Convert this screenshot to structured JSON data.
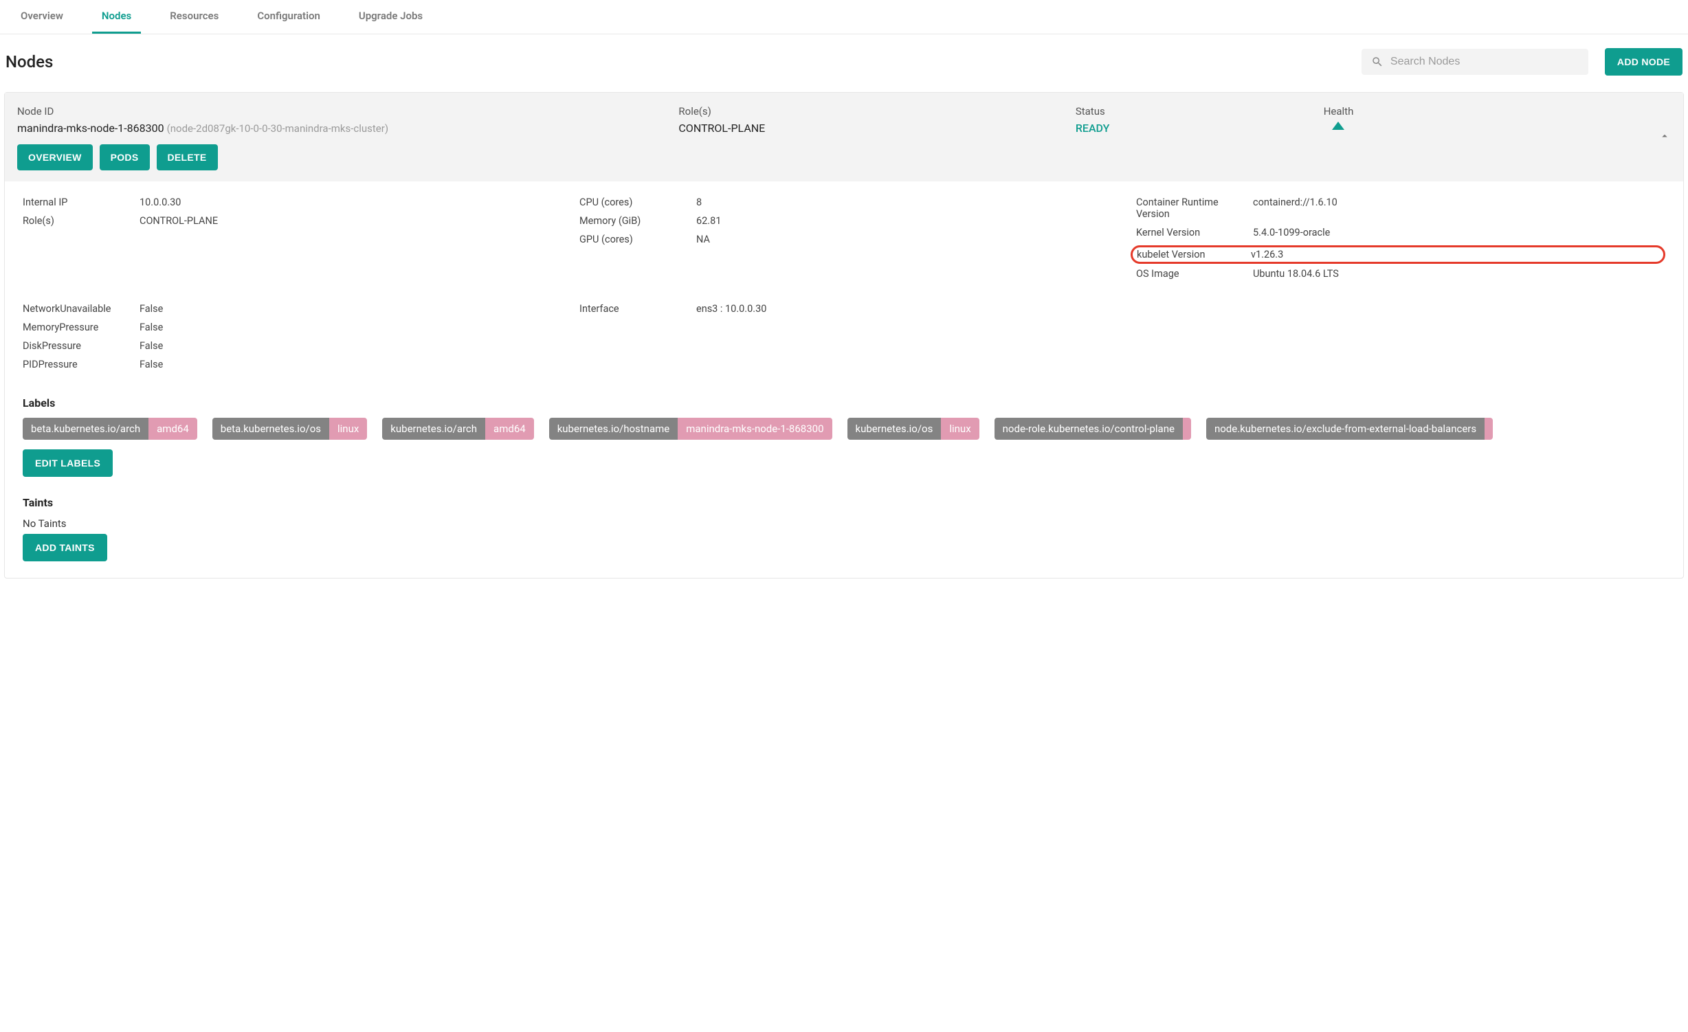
{
  "tabs": [
    "Overview",
    "Nodes",
    "Resources",
    "Configuration",
    "Upgrade Jobs"
  ],
  "active_tab": "Nodes",
  "page_title": "Nodes",
  "search": {
    "placeholder": "Search Nodes"
  },
  "add_node_label": "ADD NODE",
  "node": {
    "head": {
      "node_id_label": "Node ID",
      "node_id": "manindra-mks-node-1-868300",
      "node_id_sub": "(node-2d087gk-10-0-0-30-manindra-mks-cluster)",
      "roles_label": "Role(s)",
      "roles": "CONTROL-PLANE",
      "status_label": "Status",
      "status": "READY",
      "health_label": "Health"
    },
    "actions": {
      "overview": "OVERVIEW",
      "pods": "PODS",
      "delete": "DELETE"
    },
    "specs": {
      "col1": [
        {
          "k": "Internal IP",
          "v": "10.0.0.30"
        },
        {
          "k": "Role(s)",
          "v": "CONTROL-PLANE"
        }
      ],
      "col2": [
        {
          "k": "CPU (cores)",
          "v": "8"
        },
        {
          "k": "Memory (GiB)",
          "v": "62.81"
        },
        {
          "k": "GPU (cores)",
          "v": "NA"
        }
      ],
      "col3": [
        {
          "k": "Container Runtime Version",
          "v": "containerd://1.6.10"
        },
        {
          "k": "Kernel Version",
          "v": "5.4.0-1099-oracle"
        },
        {
          "k": "kubelet Version",
          "v": "v1.26.3",
          "highlight": true
        },
        {
          "k": "OS Image",
          "v": "Ubuntu 18.04.6 LTS"
        }
      ]
    },
    "conditions": {
      "col1": [
        {
          "k": "NetworkUnavailable",
          "v": "False"
        },
        {
          "k": "MemoryPressure",
          "v": "False"
        },
        {
          "k": "DiskPressure",
          "v": "False"
        },
        {
          "k": "PIDPressure",
          "v": "False"
        }
      ],
      "col2": [
        {
          "k": "Interface",
          "v": "ens3 : 10.0.0.30"
        }
      ]
    },
    "labels_title": "Labels",
    "labels": [
      {
        "k": "beta.kubernetes.io/arch",
        "v": "amd64"
      },
      {
        "k": "beta.kubernetes.io/os",
        "v": "linux"
      },
      {
        "k": "kubernetes.io/arch",
        "v": "amd64"
      },
      {
        "k": "kubernetes.io/hostname",
        "v": "manindra-mks-node-1-868300"
      },
      {
        "k": "kubernetes.io/os",
        "v": "linux"
      },
      {
        "k": "node-role.kubernetes.io/control-plane",
        "v": ""
      },
      {
        "k": "node.kubernetes.io/exclude-from-external-load-balancers",
        "v": ""
      }
    ],
    "edit_labels": "EDIT LABELS",
    "taints_title": "Taints",
    "taints_text": "No Taints",
    "add_taints": "ADD TAINTS"
  }
}
